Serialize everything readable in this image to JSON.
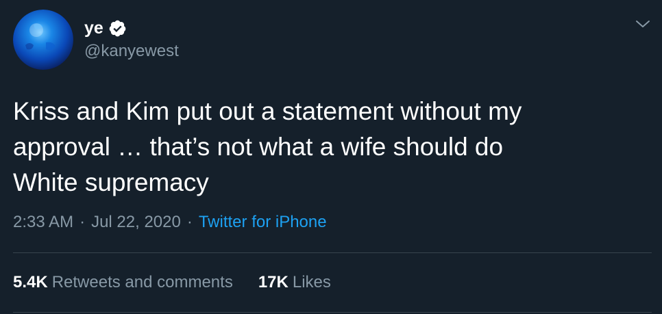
{
  "author": {
    "display_name": "ye",
    "handle": "@kanyewest",
    "verified_icon": "verified-badge-icon",
    "avatar_colors": [
      "#0a3fa8",
      "#1487e8",
      "#0c2a78"
    ]
  },
  "menu": {
    "icon": "chevron-down-icon"
  },
  "tweet": {
    "lines": [
      "Kriss and Kim put out a statement without my",
      "approval … that’s not what a wife should do",
      "White supremacy"
    ]
  },
  "meta": {
    "time": "2:33 AM",
    "separator": "·",
    "date": "Jul 22, 2020",
    "source": "Twitter for iPhone"
  },
  "stats": {
    "retweets_count": "5.4K",
    "retweets_label": "Retweets and comments",
    "likes_count": "17K",
    "likes_label": "Likes"
  },
  "colors": {
    "background": "#15202b",
    "text_primary": "#ffffff",
    "text_secondary": "#8899a6",
    "link": "#1da1f2",
    "divider": "#38444d"
  }
}
